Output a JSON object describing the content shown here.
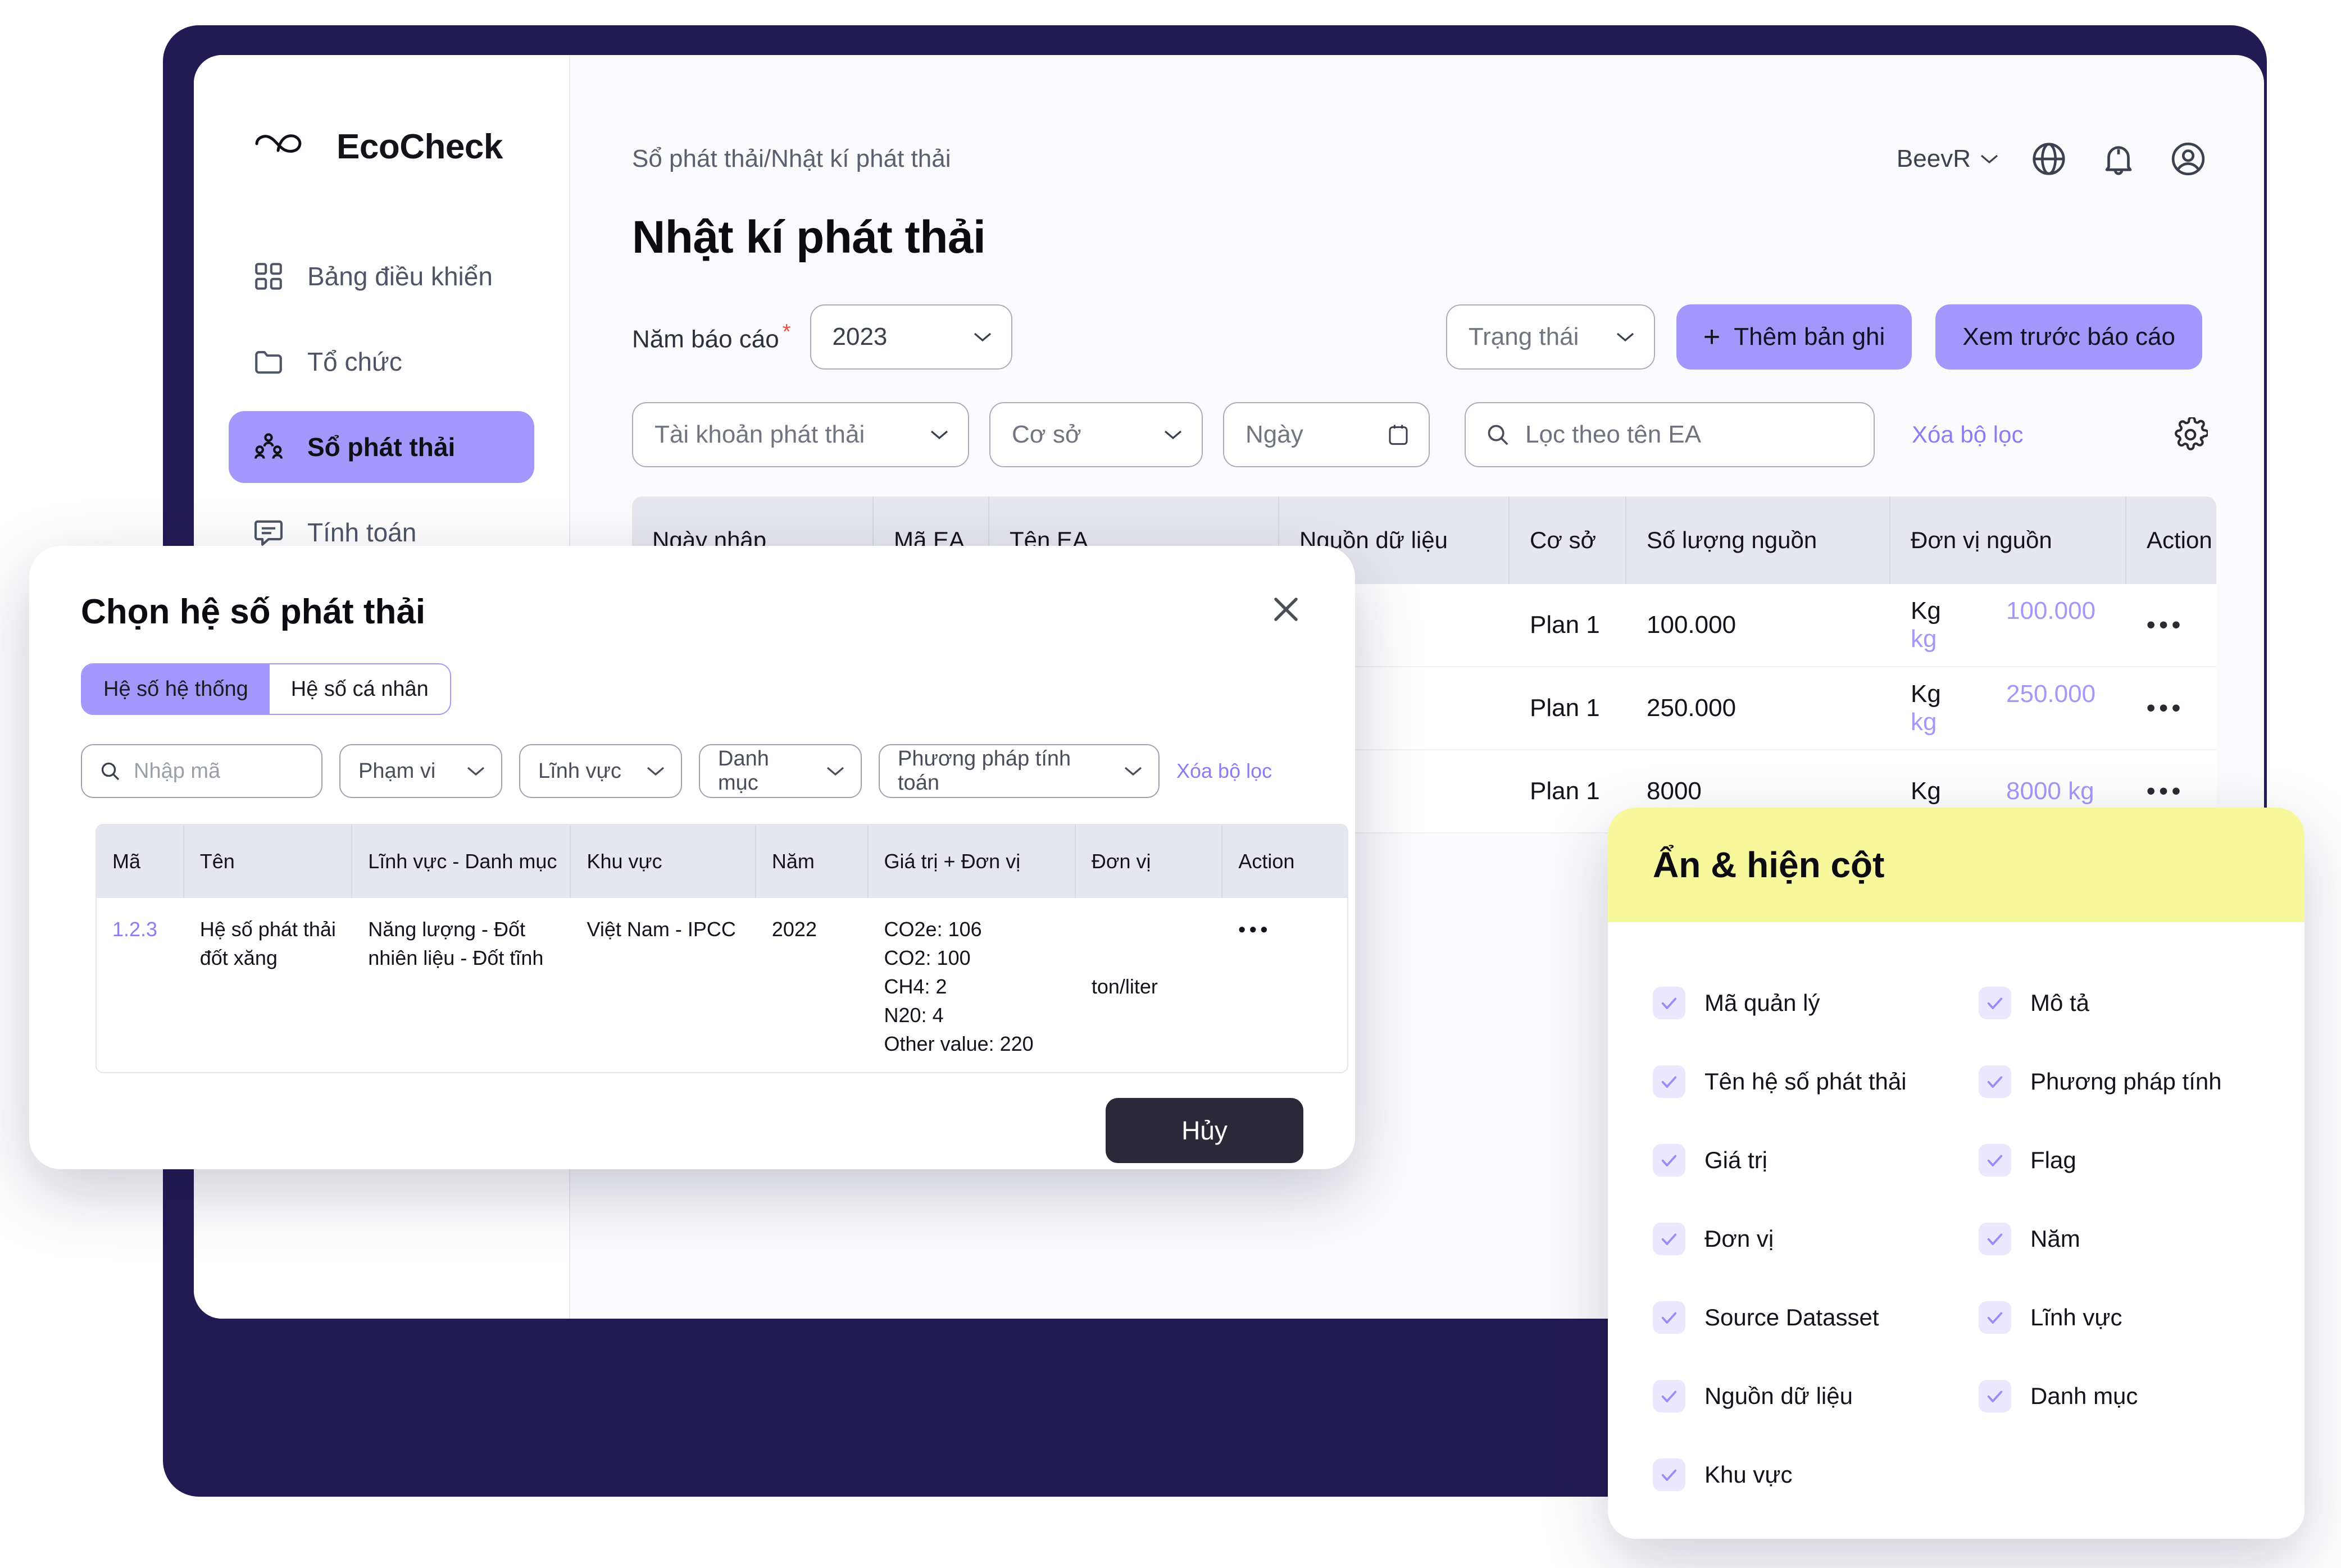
{
  "brand": {
    "name": "EcoCheck"
  },
  "sidebar": {
    "items": [
      {
        "label": "Bảng điều khiển",
        "icon": "grid-icon",
        "active": false
      },
      {
        "label": "Tổ chức",
        "icon": "folder-icon",
        "active": false
      },
      {
        "label": "Sổ phát thải",
        "icon": "users-icon",
        "active": true
      },
      {
        "label": "Tính toán",
        "icon": "message-icon",
        "active": false
      }
    ]
  },
  "topbar": {
    "breadcrumb": "Sổ phát thải/Nhật kí phát thải",
    "user": "BeevR",
    "icons": [
      "globe-icon",
      "bell-icon",
      "account-icon"
    ]
  },
  "page": {
    "title": "Nhật kí phát thải"
  },
  "filters": {
    "year_label": "Năm báo cáo",
    "year_required": "*",
    "year_value": "2023",
    "status_placeholder": "Trạng thái",
    "add_record": "Thêm bản ghi",
    "preview_report": "Xem trước báo cáo",
    "account_placeholder": "Tài khoản phát thải",
    "facility_placeholder": "Cơ sở",
    "date_placeholder": "Ngày",
    "search_placeholder": "Lọc theo tên EA",
    "clear_filters": "Xóa bộ lọc"
  },
  "table": {
    "headers": [
      "Ngày nhập",
      "Mã EA",
      "Tên EA",
      "Nguồn dữ liệu",
      "Cơ sở",
      "Số lượng nguồn",
      "Đơn vị nguồn",
      "Action"
    ],
    "rows": [
      {
        "ngay_nhap": "",
        "ma_ea": "",
        "ten_ea": "",
        "nguon_du_lieu": "",
        "co_so": "Plan 1",
        "so_luong_nguon": "100.000",
        "don_vi_nguon": "Kg",
        "value": "100.000 kg",
        "action": "•••"
      },
      {
        "ngay_nhap": "",
        "ma_ea": "",
        "ten_ea": "",
        "nguon_du_lieu": "",
        "co_so": "Plan 1",
        "so_luong_nguon": "250.000",
        "don_vi_nguon": "Kg",
        "value": "250.000 kg",
        "action": "•••"
      },
      {
        "ngay_nhap": "",
        "ma_ea": "",
        "ten_ea": "",
        "nguon_du_lieu": "",
        "co_so": "Plan 1",
        "so_luong_nguon": "8000",
        "don_vi_nguon": "Kg",
        "value": "8000 kg",
        "action": "•••"
      }
    ]
  },
  "modal": {
    "title": "Chọn hệ số phát thải",
    "tabs": [
      {
        "label": "Hệ số hệ thống",
        "active": true
      },
      {
        "label": "Hệ số cá nhân",
        "active": false
      }
    ],
    "filters": {
      "code_placeholder": "Nhập mã",
      "scope_placeholder": "Phạm vi",
      "field_placeholder": "Lĩnh vực",
      "category_placeholder": "Danh mục",
      "method_placeholder": "Phương pháp tính toán",
      "clear_filters": "Xóa bộ lọc"
    },
    "headers": [
      "Mã",
      "Tên",
      "Lĩnh vực - Danh mục",
      "Khu vực",
      "Năm",
      "Giá trị + Đơn vị",
      "Đơn vị",
      "Action"
    ],
    "rows": [
      {
        "ma": "1.2.3",
        "ten": "Hệ số phát thải đốt xăng",
        "linh_vuc": "Năng lượng - Đốt nhiên liệu - Đốt tĩnh",
        "khu_vuc": "Việt Nam - IPCC",
        "nam": "2022",
        "gia_tri": "CO2e: 106\nCO2: 100\nCH4: 2\nN20: 4\nOther value: 220",
        "don_vi": "ton/liter",
        "action": "•••"
      }
    ],
    "cancel": "Hủy"
  },
  "column_panel": {
    "title": "Ẩn & hiện cột",
    "items": [
      {
        "label": "Mã quản lý",
        "checked": true
      },
      {
        "label": "Mô tả",
        "checked": true
      },
      {
        "label": "Tên hệ số phát thải",
        "checked": true
      },
      {
        "label": "Phương pháp tính",
        "checked": true
      },
      {
        "label": "Giá trị",
        "checked": true
      },
      {
        "label": "Flag",
        "checked": true
      },
      {
        "label": "Đơn vị",
        "checked": true
      },
      {
        "label": "Năm",
        "checked": true
      },
      {
        "label": "Source Datasset",
        "checked": true
      },
      {
        "label": "Lĩnh vực",
        "checked": true
      },
      {
        "label": "Nguồn dữ liệu",
        "checked": true
      },
      {
        "label": "Danh mục",
        "checked": true
      },
      {
        "label": "Khu vực",
        "checked": true
      }
    ]
  },
  "colors": {
    "accent": "#a497fb",
    "backdrop": "#221a52",
    "panel_header": "#f7f79c",
    "dark_button": "#2b2838",
    "required": "#ee4b46"
  }
}
